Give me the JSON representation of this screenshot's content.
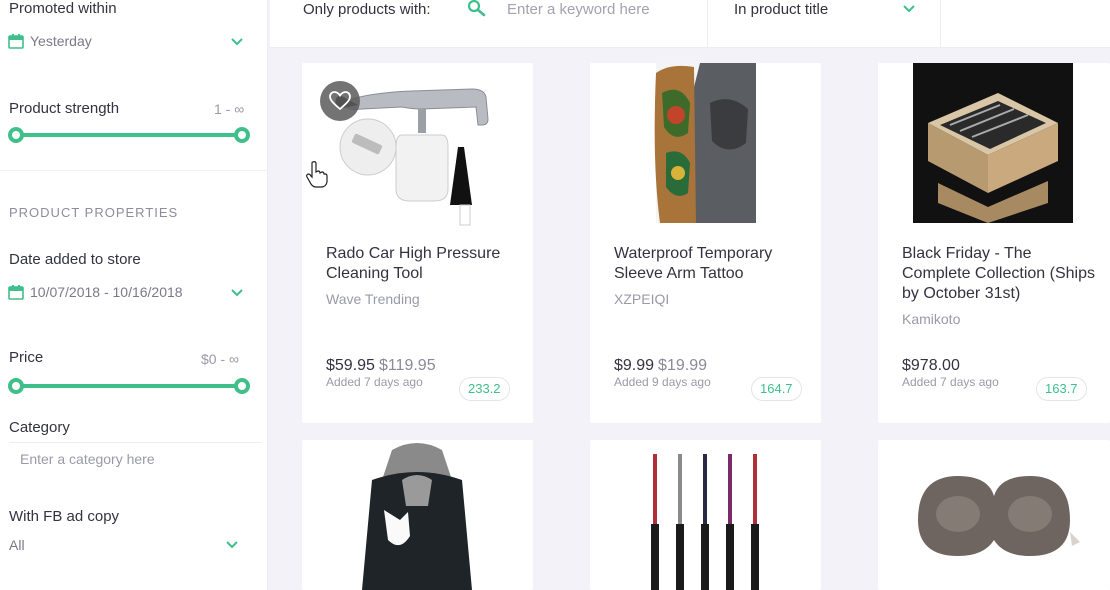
{
  "sidebar": {
    "promoted_within": {
      "label": "Promoted within",
      "value": "Yesterday"
    },
    "product_strength": {
      "label": "Product strength",
      "range": "1 - ∞"
    },
    "section_title": "PRODUCT PROPERTIES",
    "date_added": {
      "label": "Date added to store",
      "value": "10/07/2018 - 10/16/2018"
    },
    "price": {
      "label": "Price",
      "range": "$0 - ∞"
    },
    "category": {
      "label": "Category",
      "placeholder": "Enter a category here"
    },
    "fb_ad_copy": {
      "label": "With FB ad copy",
      "value": "All"
    }
  },
  "topbar": {
    "label": "Only products with:",
    "search_placeholder": "Enter a keyword here",
    "scope_select": "In product title"
  },
  "products": [
    {
      "title": "Rado Car High Pressure Cleaning Tool",
      "vendor": "Wave Trending",
      "price": "$59.95",
      "old_price": "$119.95",
      "added": "Added 7 days ago",
      "score": "233.2"
    },
    {
      "title": "Waterproof Temporary Sleeve Arm Tattoo",
      "vendor": "XZPEIQI",
      "price": "$9.99",
      "old_price": "$19.99",
      "added": "Added 9 days ago",
      "score": "164.7"
    },
    {
      "title": "Black Friday - The Complete Collection (Ships by October 31st)",
      "vendor": "Kamikoto",
      "price": "$978.00",
      "old_price": "",
      "added": "Added 7 days ago",
      "score": "163.7"
    }
  ],
  "colors": {
    "accent": "#3fbf8a",
    "background": "#f3f2f8"
  }
}
